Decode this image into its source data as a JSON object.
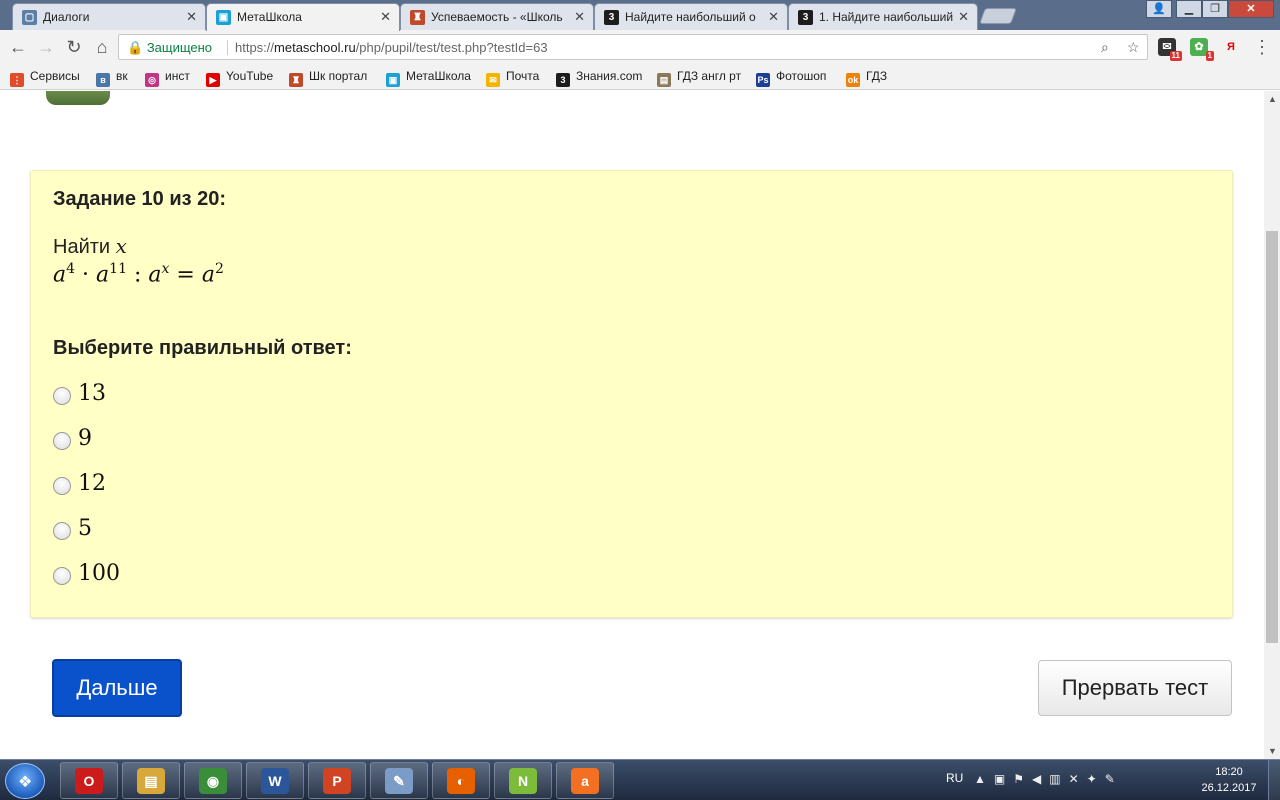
{
  "browser": {
    "tabs": [
      {
        "title": "Диалоги",
        "icon": "vk-dialogs-icon",
        "color": "#5b7fa6"
      },
      {
        "title": "МетаШкола",
        "icon": "metaschool-icon",
        "color": "#1ba1d5",
        "active": true
      },
      {
        "title": "Успеваемость - «Школь",
        "icon": "school-portal-icon",
        "color": "#c0492a"
      },
      {
        "title": "Найдите наибольший о",
        "icon": "znanija-icon",
        "color": "#1d1d1d"
      },
      {
        "title": "1. Найдите наибольший",
        "icon": "znanija-icon",
        "color": "#1d1d1d"
      }
    ],
    "omnibox": {
      "secure_label": "Защищено",
      "url_scheme": "https://",
      "url_host": "metaschool.ru",
      "url_path": "/php/pupil/test/test.php?testId=63"
    },
    "extensions": [
      {
        "icon": "mail-extension-icon",
        "badge": "11"
      },
      {
        "icon": "addon-extension-icon",
        "badge": "1"
      },
      {
        "icon": "yandex-icon",
        "label": "Я"
      }
    ],
    "bookmarks": [
      {
        "label": "Сервисы",
        "icon": "apps-grid-icon",
        "color": "#e04b2a"
      },
      {
        "label": "вк",
        "icon": "vk-icon",
        "color": "#4a76a8"
      },
      {
        "label": "инст",
        "icon": "instagram-icon",
        "color": "#c13584"
      },
      {
        "label": "YouTube",
        "icon": "youtube-icon",
        "color": "#e00000"
      },
      {
        "label": "Шк портал",
        "icon": "school-portal-icon",
        "color": "#c0492a"
      },
      {
        "label": "МетаШкола",
        "icon": "metaschool-icon",
        "color": "#1ba1d5"
      },
      {
        "label": "Почта",
        "icon": "mail-icon",
        "color": "#f4b400"
      },
      {
        "label": "Знания.com",
        "icon": "znanija-icon",
        "color": "#1d1d1d"
      },
      {
        "label": "ГДЗ англ рт",
        "icon": "gdz-icon",
        "color": "#8a7a5a"
      },
      {
        "label": "Фотошоп",
        "icon": "photoshop-icon",
        "color": "#1c3f94"
      },
      {
        "label": "ГДЗ",
        "icon": "ok-icon",
        "color": "#ee8208"
      }
    ]
  },
  "task": {
    "title": "Задание 10 из 20:",
    "question_prefix": "Найти",
    "question_var": "x",
    "choose_label": "Выберите правильный ответ:",
    "options": [
      "13",
      "9",
      "12",
      "5",
      "100"
    ]
  },
  "buttons": {
    "next_label": "Дальше",
    "abort_label": "Прервать тест"
  },
  "taskbar": {
    "apps": [
      {
        "icon": "opera-icon",
        "color": "#cc1b1b",
        "label": "O"
      },
      {
        "icon": "file-explorer-icon",
        "color": "#d8a93a",
        "label": "▤"
      },
      {
        "icon": "chrome-icon",
        "color": "#3a8e3a",
        "label": "◉"
      },
      {
        "icon": "word-icon",
        "color": "#2b579a",
        "label": "W"
      },
      {
        "icon": "powerpoint-icon",
        "color": "#d04423",
        "label": "P"
      },
      {
        "icon": "paint-icon",
        "color": "#7a9cc6",
        "label": "✎"
      },
      {
        "icon": "firefox-icon",
        "color": "#e66000",
        "label": "◐"
      },
      {
        "icon": "notepad-plus-icon",
        "color": "#7dbb3a",
        "label": "N"
      },
      {
        "icon": "avast-icon",
        "color": "#f36f21",
        "label": "a"
      }
    ],
    "language": "RU",
    "time": "18:20",
    "date": "26.12.2017"
  }
}
